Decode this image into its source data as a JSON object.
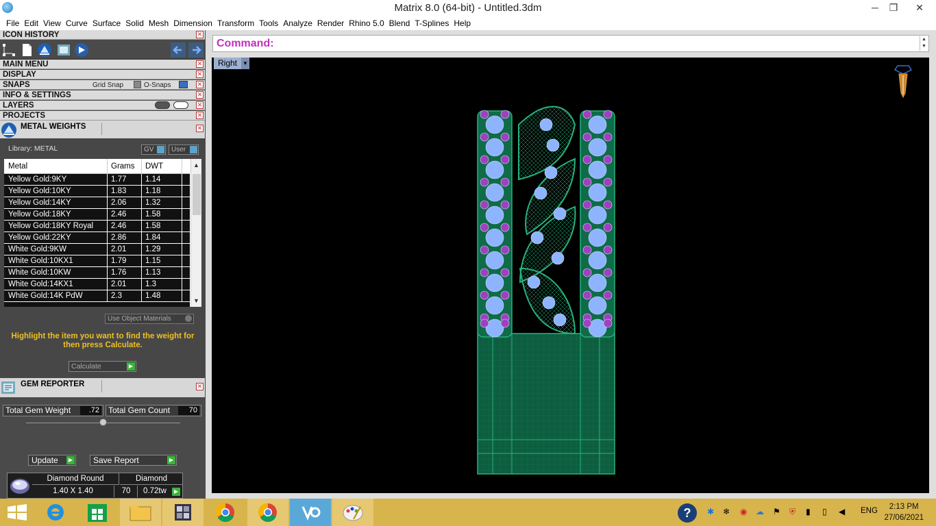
{
  "window": {
    "title": "Matrix 8.0 (64-bit) - Untitled.3dm",
    "minimize": "─",
    "maximize": "❐",
    "close": "✕"
  },
  "menu": [
    "File",
    "Edit",
    "View",
    "Curve",
    "Surface",
    "Solid",
    "Mesh",
    "Dimension",
    "Transform",
    "Tools",
    "Analyze",
    "Render",
    "Rhino 5.0",
    "Blend",
    "T-Splines",
    "Help"
  ],
  "panels": {
    "icon_history": "ICON HISTORY",
    "main_menu": "MAIN MENU",
    "display": "DISPLAY",
    "snaps": "SNAPS",
    "grid_snap": "Grid Snap",
    "o_snaps": "O-Snaps",
    "info_settings": "INFO & SETTINGS",
    "layers": "LAYERS",
    "projects": "PROJECTS"
  },
  "metal_weights": {
    "title": "METAL WEIGHTS",
    "library": "Library: METAL",
    "gv": "GV",
    "user": "User",
    "columns": [
      "Metal",
      "Grams",
      "DWT"
    ],
    "rows": [
      [
        "Yellow Gold:9KY",
        "1.77",
        "1.14"
      ],
      [
        "Yellow Gold:10KY",
        "1.83",
        "1.18"
      ],
      [
        "Yellow Gold:14KY",
        "2.06",
        "1.32"
      ],
      [
        "Yellow Gold:18KY",
        "2.46",
        "1.58"
      ],
      [
        "Yellow Gold:18KY Royal",
        "2.46",
        "1.58"
      ],
      [
        "Yellow Gold:22KY",
        "2.86",
        "1.84"
      ],
      [
        "White Gold:9KW",
        "2.01",
        "1.29"
      ],
      [
        "White Gold:10KX1",
        "1.79",
        "1.15"
      ],
      [
        "White Gold:10KW",
        "1.76",
        "1.13"
      ],
      [
        "White Gold:14KX1",
        "2.01",
        "1.3"
      ],
      [
        "White Gold:14K PdW",
        "2.3",
        "1.48"
      ]
    ],
    "use_object_materials": "Use Object Materials",
    "hint": "Highlight the item you want to find the weight for then press Calculate.",
    "calculate": "Calculate"
  },
  "gem_reporter": {
    "title": "GEM REPORTER",
    "total_weight_label": "Total Gem Weight",
    "total_weight": ".72",
    "total_count_label": "Total Gem Count",
    "total_count": "70",
    "update": "Update",
    "save_report": "Save Report",
    "gem": {
      "shape": "Diamond Round",
      "material": "Diamond",
      "size": "1.40 X 1.40",
      "count": "70",
      "weight": "0.72tw"
    }
  },
  "command": {
    "label": "Command:"
  },
  "viewport": {
    "name": "Right"
  },
  "taskbar": {
    "apps": [
      "start-icon",
      "internet-explorer-icon",
      "store-icon",
      "file-explorer-icon",
      "matrix-app-icon",
      "chrome-icon",
      "chrome-icon-2",
      "vsdc-icon",
      "paint-icon"
    ],
    "lang": "ENG",
    "time": "2:13 PM",
    "date": "27/06/2021"
  },
  "colors": {
    "mesh_green": "#1f9a6a",
    "gem_blue": "#8fb4ff",
    "gem_purple": "#a040c0",
    "command_magenta": "#c030c0",
    "hint_yellow": "#f0c020",
    "taskbar": "#d8b44c"
  }
}
